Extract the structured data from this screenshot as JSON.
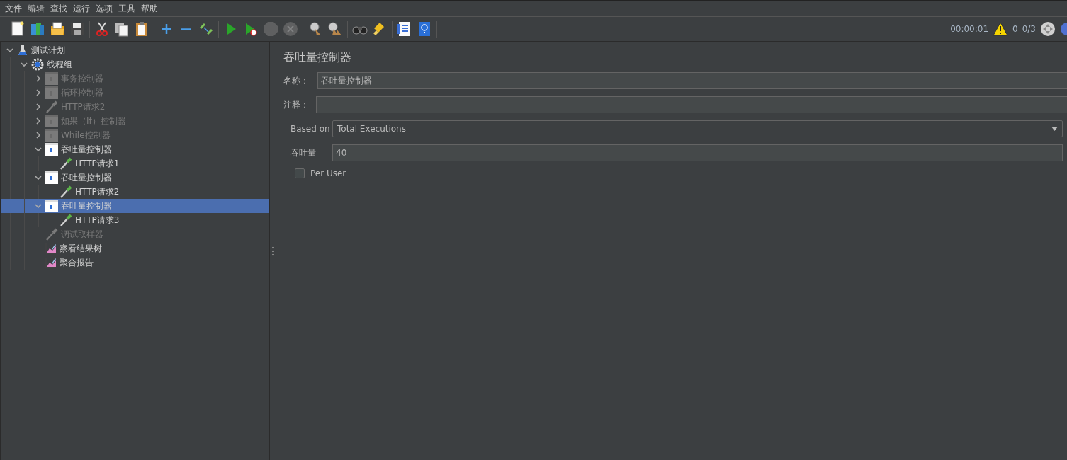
{
  "menu": [
    "文件",
    "编辑",
    "查找",
    "运行",
    "选项",
    "工具",
    "帮助"
  ],
  "toolbar": [
    [
      {
        "kind": "new",
        "disabled": false
      },
      {
        "kind": "templates",
        "disabled": false
      },
      {
        "kind": "open",
        "disabled": false
      },
      {
        "kind": "save",
        "disabled": false
      }
    ],
    [
      {
        "kind": "cut",
        "disabled": false
      },
      {
        "kind": "copy",
        "disabled": false
      },
      {
        "kind": "paste",
        "disabled": false
      }
    ],
    [
      {
        "kind": "expand",
        "disabled": false
      },
      {
        "kind": "collapse",
        "disabled": false
      },
      {
        "kind": "toggle",
        "disabled": false
      }
    ],
    [
      {
        "kind": "start",
        "disabled": false
      },
      {
        "kind": "start-no-timers",
        "disabled": false
      },
      {
        "kind": "stop",
        "disabled": true
      },
      {
        "kind": "shutdown",
        "disabled": true
      }
    ],
    [
      {
        "kind": "clear",
        "disabled": false
      },
      {
        "kind": "clear-all",
        "disabled": false
      }
    ],
    [
      {
        "kind": "search",
        "disabled": false
      },
      {
        "kind": "reset-search",
        "disabled": false
      }
    ],
    [
      {
        "kind": "functions",
        "disabled": false
      },
      {
        "kind": "help",
        "disabled": false
      }
    ]
  ],
  "status": {
    "elapsed": "00:00:01",
    "warnings": "0",
    "threads": "0/3"
  },
  "tree": [
    {
      "label": "测试计划",
      "kind": "plan",
      "disabled": false,
      "selected": false,
      "expanded": true,
      "children": [
        {
          "label": "线程组",
          "kind": "thread-group",
          "disabled": false,
          "selected": false,
          "expanded": true,
          "children": [
            {
              "label": "事务控制器",
              "kind": "controller",
              "disabled": true,
              "selected": false,
              "expanded": false
            },
            {
              "label": "循环控制器",
              "kind": "controller",
              "disabled": true,
              "selected": false,
              "expanded": false
            },
            {
              "label": "HTTP请求2",
              "kind": "sampler",
              "disabled": true,
              "selected": false,
              "expanded": false
            },
            {
              "label": "如果（If）控制器",
              "kind": "controller",
              "disabled": true,
              "selected": false,
              "expanded": false
            },
            {
              "label": "While控制器",
              "kind": "controller",
              "disabled": true,
              "selected": false,
              "expanded": false
            },
            {
              "label": "吞吐量控制器",
              "kind": "controller",
              "disabled": false,
              "selected": false,
              "expanded": true,
              "children": [
                {
                  "label": "HTTP请求1",
                  "kind": "sampler",
                  "disabled": false,
                  "selected": false
                }
              ]
            },
            {
              "label": "吞吐量控制器",
              "kind": "controller",
              "disabled": false,
              "selected": false,
              "expanded": true,
              "children": [
                {
                  "label": "HTTP请求2",
                  "kind": "sampler",
                  "disabled": false,
                  "selected": false
                }
              ]
            },
            {
              "label": "吞吐量控制器",
              "kind": "controller",
              "disabled": false,
              "selected": true,
              "expanded": true,
              "children": [
                {
                  "label": "HTTP请求3",
                  "kind": "sampler",
                  "disabled": false,
                  "selected": false
                }
              ]
            },
            {
              "label": "调试取样器",
              "kind": "sampler",
              "disabled": true,
              "selected": false
            },
            {
              "label": "察看结果树",
              "kind": "listener",
              "disabled": false,
              "selected": false
            },
            {
              "label": "聚合报告",
              "kind": "listener",
              "disabled": false,
              "selected": false
            }
          ]
        }
      ]
    }
  ],
  "panel": {
    "title": "吞吐量控制器",
    "name": {
      "label": "名称：",
      "value": "吞吐量控制器"
    },
    "comment": {
      "label": "注释："
    },
    "based_on": {
      "label": "Based on",
      "value": "Total Executions"
    },
    "throughput": {
      "label": "吞吐量",
      "value": "40"
    },
    "per_user": {
      "label": "Per User",
      "checked": false
    }
  }
}
